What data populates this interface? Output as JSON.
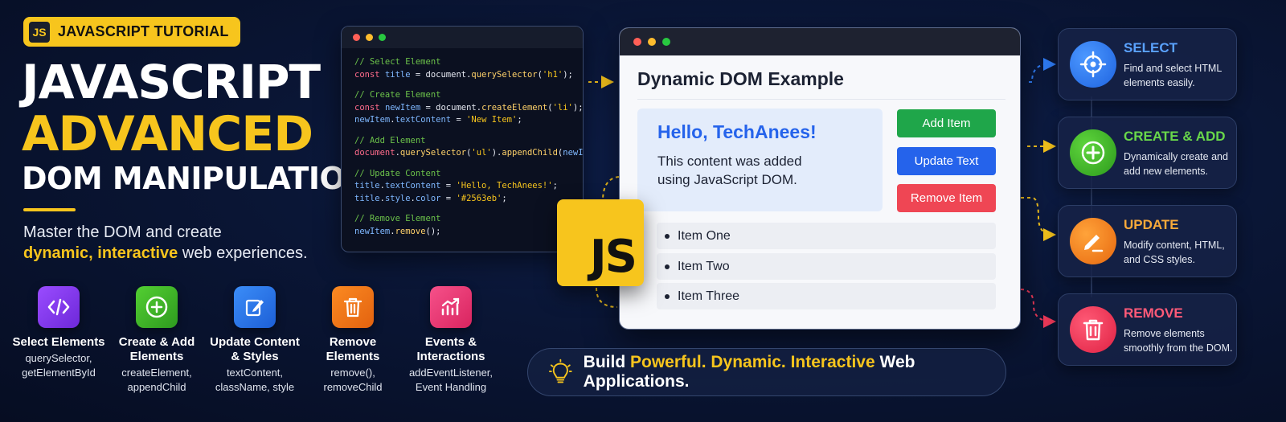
{
  "badge": {
    "logo": "JS",
    "label": "JAVASCRIPT TUTORIAL"
  },
  "hero": {
    "line1": "JAVASCRIPT",
    "line2": "ADVANCED",
    "line3": "DOM MANIPULATION",
    "subtitle_line1": "Master the DOM and create",
    "subtitle_highlight": "dynamic, interactive",
    "subtitle_rest": " web experiences."
  },
  "features": [
    {
      "icon": "code-icon",
      "title": "Select Elements",
      "desc": "querySelector, getElementById",
      "color": "#8a3ff5"
    },
    {
      "icon": "plus-circle-icon",
      "title": "Create & Add Elements",
      "desc": "createElement, appendChild",
      "color": "#3fbb2a"
    },
    {
      "icon": "edit-icon",
      "title": "Update Content & Styles",
      "desc": "textContent, className, style",
      "color": "#2a7cf5"
    },
    {
      "icon": "trash-icon",
      "title": "Remove Elements",
      "desc": "remove(), removeChild",
      "color": "#f47a1a"
    },
    {
      "icon": "chart-up-icon",
      "title": "Events & Interactions",
      "desc": "addEventListener, Event Handling",
      "color": "#ee3d7a"
    }
  ],
  "code": {
    "comment_select": "// Select Element",
    "comment_create": "// Create Element",
    "comment_add": "// Add Element",
    "comment_update": "// Update Content",
    "comment_remove": "// Remove Element"
  },
  "browser": {
    "title": "Dynamic DOM Example",
    "hello": "Hello, TechAnees!",
    "message": "This content was added using JavaScript DOM.",
    "buttons": {
      "add": "Add Item",
      "update": "Update Text",
      "remove": "Remove Item"
    },
    "list": [
      "Item One",
      "Item Two",
      "Item Three"
    ]
  },
  "js_logo": "JS",
  "banner": {
    "build": "Build",
    "powerful": "Powerful.",
    "dynamic": "Dynamic.",
    "interactive": "Interactive",
    "rest": "Web Applications."
  },
  "cards": [
    {
      "icon": "crosshair-icon",
      "title": "SELECT",
      "desc": "Find and select HTML elements easily.",
      "color": "#2f7df6",
      "title_color": "#5aa2ff"
    },
    {
      "icon": "plus-circle-icon",
      "title": "CREATE & ADD",
      "desc": "Dynamically create and add new elements.",
      "color": "#3fb42a",
      "title_color": "#69d84a"
    },
    {
      "icon": "pencil-icon",
      "title": "UPDATE",
      "desc": "Modify content, HTML, and CSS styles.",
      "color": "#f58a1c",
      "title_color": "#f7a93a"
    },
    {
      "icon": "trash-icon",
      "title": "REMOVE",
      "desc": "Remove elements smoothly from the DOM.",
      "color": "#f03a5a",
      "title_color": "#ff5a78"
    }
  ]
}
